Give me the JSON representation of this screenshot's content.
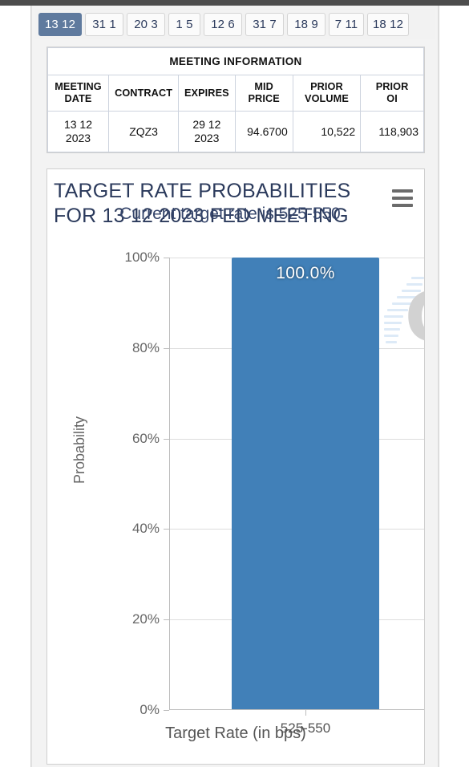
{
  "tabs": [
    {
      "label": "13 12",
      "active": true
    },
    {
      "label": "31 1",
      "active": false
    },
    {
      "label": "20 3",
      "active": false
    },
    {
      "label": "1 5",
      "active": false
    },
    {
      "label": "12 6",
      "active": false
    },
    {
      "label": "31 7",
      "active": false
    },
    {
      "label": "18 9",
      "active": false
    },
    {
      "label": "7 11",
      "active": false
    },
    {
      "label": "18 12",
      "active": false
    }
  ],
  "meeting_table": {
    "title": "MEETING INFORMATION",
    "columns": [
      "MEETING DATE",
      "CONTRACT",
      "EXPIRES",
      "MID PRICE",
      "PRIOR VOLUME",
      "PRIOR OI"
    ],
    "columns_lines": [
      [
        "MEETING",
        "DATE"
      ],
      [
        "CONTRACT"
      ],
      [
        "EXPIRES"
      ],
      [
        "MID",
        "PRICE"
      ],
      [
        "PRIOR",
        "VOLUME"
      ],
      [
        "PRIOR",
        "OI"
      ]
    ],
    "rows": [
      {
        "meeting_date": "13 12 2023",
        "meeting_date_line1": "13 12",
        "meeting_date_line2": "2023",
        "contract": "ZQZ3",
        "expires": "29 12 2023",
        "expires_line1": "29 12",
        "expires_line2": "2023",
        "mid_price": "94.6700",
        "prior_volume": "10,522",
        "prior_oi": "118,903"
      }
    ]
  },
  "chart": {
    "menu_icon": "hamburger-menu-icon",
    "watermark_letter": "Q",
    "bar_color": "#4180b8",
    "title_color": "#2b3a5c"
  },
  "chart_data": {
    "type": "bar",
    "title": "TARGET RATE PROBABILITIES FOR 13 12 2023 FED MEETING",
    "subtitle": "Current target rate is 525-550",
    "categories": [
      "525-550"
    ],
    "values": [
      100.0
    ],
    "data_labels": [
      "100.0%"
    ],
    "xlabel": "Target Rate (in bps)",
    "ylabel": "Probability",
    "ylim": [
      0,
      100
    ],
    "ytick_labels": [
      "0%",
      "20%",
      "40%",
      "60%",
      "80%",
      "100%"
    ],
    "ytick_values": [
      0,
      20,
      40,
      60,
      80,
      100
    ],
    "grid": true,
    "legend": false
  }
}
